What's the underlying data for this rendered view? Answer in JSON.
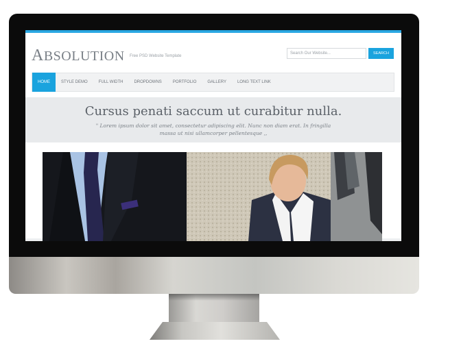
{
  "site": {
    "logo": {
      "initial": "A",
      "rest": "BSOLUTION"
    },
    "tagline": "Free PSD Website Template",
    "search": {
      "placeholder": "Search Our Website...",
      "button": "SEARCH"
    },
    "nav": [
      "HOME",
      "STYLE DEMO",
      "FULL WIDTH",
      "DROPDOWNS",
      "PORTFOLIO",
      "GALLERY",
      "LONG TEXT LINK"
    ],
    "hero": {
      "title": "Cursus penati saccum ut curabitur nulla.",
      "text": "\" Lorem ipsum dolor sit amet, consectetur adipiscing elit. Nunc non diam erat. In fringilla massa ut nisi ullamcorper pellentesque ,,"
    }
  },
  "colors": {
    "accent": "#1aa3de",
    "top_bar": "#2aa7e2",
    "bezel": "#0b0b0b"
  },
  "icons": [
    "monitor-illustration"
  ]
}
